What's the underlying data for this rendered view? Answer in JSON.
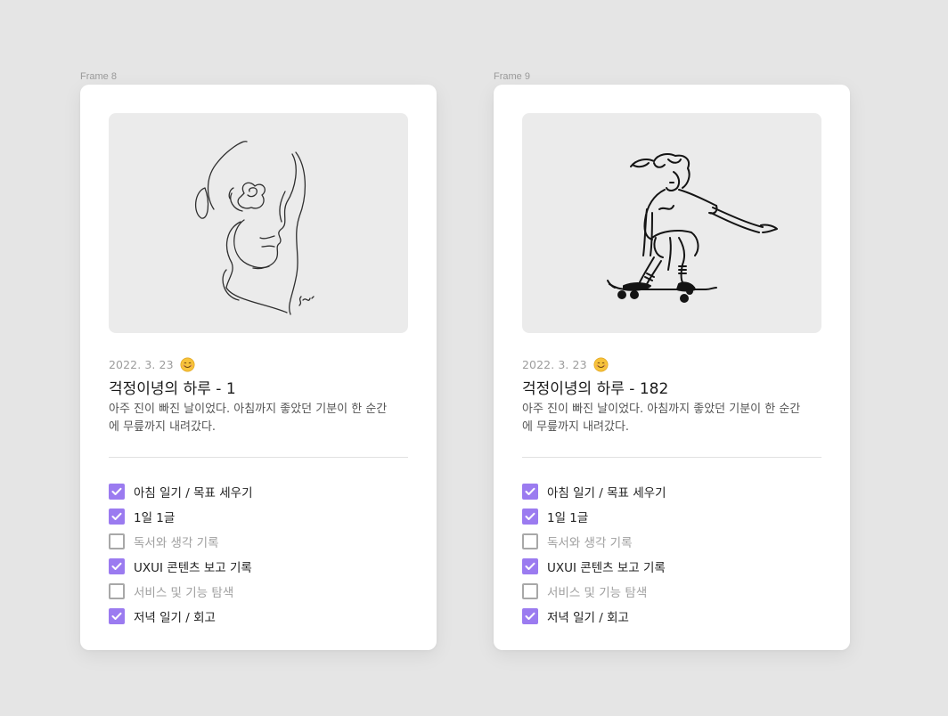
{
  "colors": {
    "canvas": "#e5e5e5",
    "card": "#ffffff",
    "accent": "#9b7bf0",
    "muted_text": "#a0a0a0"
  },
  "cards": [
    {
      "frame_label": "Frame 8",
      "illustration": "one-line-face-with-rose",
      "date": "2022. 3. 23",
      "mood_icon": "smiling-face-icon",
      "title": "걱정이녕의 하루 - 1",
      "desc_line1": "아주 진이 빠진 날이었다. 아침까지 좋았던 기분이 한 순간",
      "desc_line2": "에 무릎까지 내려갔다.",
      "checklist": [
        {
          "label": "아침 일기 / 목표 세우기",
          "checked": true
        },
        {
          "label": "1일 1글",
          "checked": true
        },
        {
          "label": "독서와 생각 기록",
          "checked": false
        },
        {
          "label": "UXUI 콘텐츠 보고 기록",
          "checked": true
        },
        {
          "label": "서비스 및 기능 탐색",
          "checked": false
        },
        {
          "label": "저녁 일기 / 회고",
          "checked": true
        }
      ]
    },
    {
      "frame_label": "Frame 9",
      "illustration": "skateboarder-drawing",
      "date": "2022. 3. 23",
      "mood_icon": "smiling-face-icon",
      "title": "걱정이녕의 하루 - 182",
      "desc_line1": "아주 진이 빠진 날이었다. 아침까지 좋았던 기분이 한 순간",
      "desc_line2": "에 무릎까지 내려갔다.",
      "checklist": [
        {
          "label": "아침 일기 / 목표 세우기",
          "checked": true
        },
        {
          "label": "1일 1글",
          "checked": true
        },
        {
          "label": "독서와 생각 기록",
          "checked": false
        },
        {
          "label": "UXUI 콘텐츠 보고 기록",
          "checked": true
        },
        {
          "label": "서비스 및 기능 탐색",
          "checked": false
        },
        {
          "label": "저녁 일기 / 회고",
          "checked": true
        }
      ]
    }
  ]
}
